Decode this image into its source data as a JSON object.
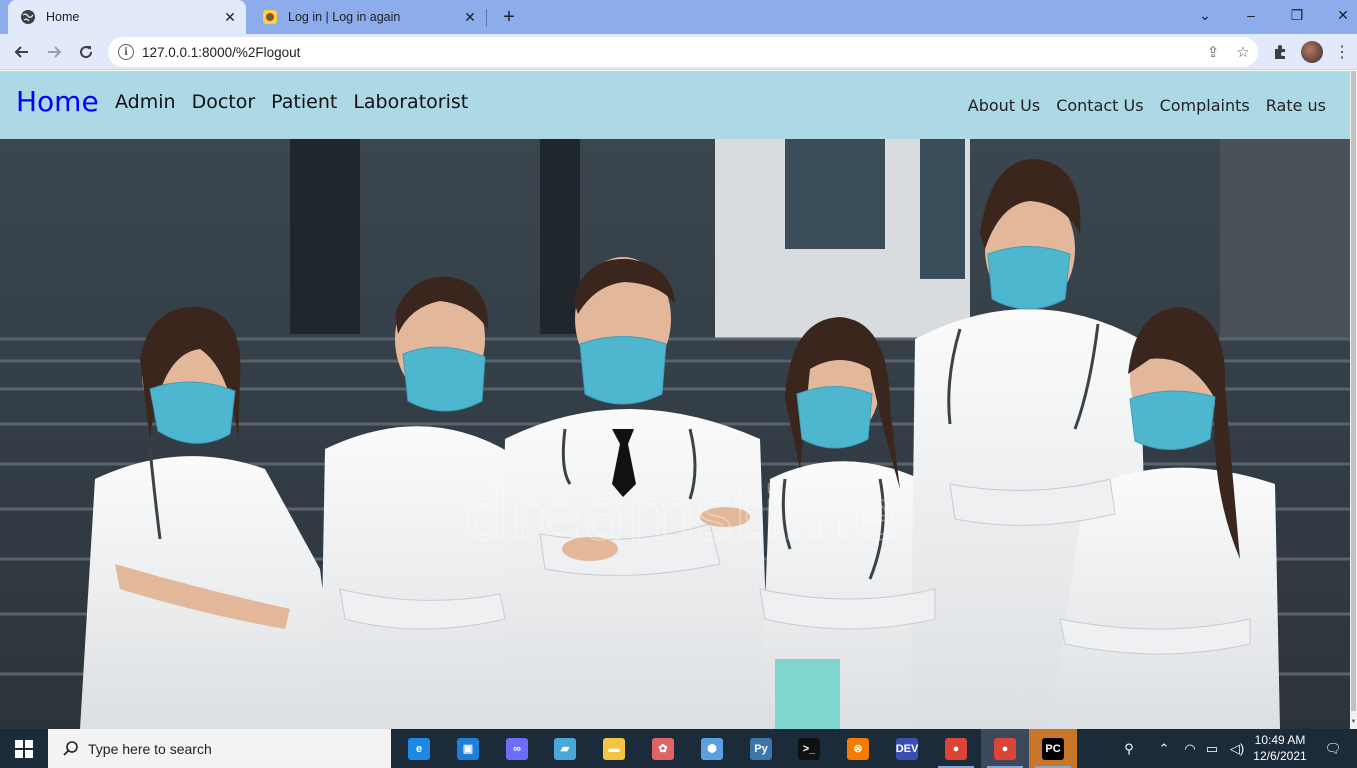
{
  "browser": {
    "tabs": [
      {
        "title": "Home",
        "icon": "globe-icon",
        "active": true
      },
      {
        "title": "Log in | Log in again",
        "icon": "django-favicon-icon",
        "active": false
      }
    ],
    "url": "127.0.0.1:8000/%2Flogout",
    "window_controls": {
      "minimize": "–",
      "restore": "❐",
      "close": "✕",
      "tab_list": "⌄"
    }
  },
  "site": {
    "brand": "Home",
    "nav_left": [
      "Admin",
      "Doctor",
      "Patient",
      "Laboratorist"
    ],
    "nav_right": [
      "About Us",
      "Contact Us",
      "Complaints",
      "Rate us"
    ],
    "hero_watermark": "dreamstime"
  },
  "taskbar": {
    "search_placeholder": "Type here to search",
    "time": "10:49 AM",
    "date": "12/6/2021",
    "pinned": [
      {
        "name": "edge-icon",
        "color": "#1e88e5",
        "label": "e"
      },
      {
        "name": "sandbox-icon",
        "color": "#1e7fd8",
        "label": "▣"
      },
      {
        "name": "infinity-icon",
        "color": "#6c6cff",
        "label": "∞"
      },
      {
        "name": "notes-icon",
        "color": "#4aa8d8",
        "label": "▰"
      },
      {
        "name": "file-explorer-icon",
        "color": "#f4c542",
        "label": "▬"
      },
      {
        "name": "paint-icon",
        "color": "#e06464",
        "label": "✿"
      },
      {
        "name": "box-3d-icon",
        "color": "#5aa0e0",
        "label": "⬢"
      },
      {
        "name": "python-icon",
        "color": "#3b77a8",
        "label": "Py"
      },
      {
        "name": "terminal-icon",
        "color": "#111111",
        "label": ">_"
      },
      {
        "name": "xampp-icon",
        "color": "#f57c00",
        "label": "⊗"
      },
      {
        "name": "devcpp-icon",
        "color": "#3a4fb0",
        "label": "DEV"
      },
      {
        "name": "chrome-icon",
        "color": "#db4437",
        "label": "●"
      },
      {
        "name": "chrome-profile-icon",
        "color": "#db4437",
        "label": "●"
      },
      {
        "name": "pycharm-icon",
        "color": "#000000",
        "label": "PC"
      }
    ]
  },
  "colors": {
    "nav_bg": "#add8e6",
    "brand": "#0000ff",
    "tabstrip": "#8cacec",
    "taskbar": "#1c2b3a"
  }
}
